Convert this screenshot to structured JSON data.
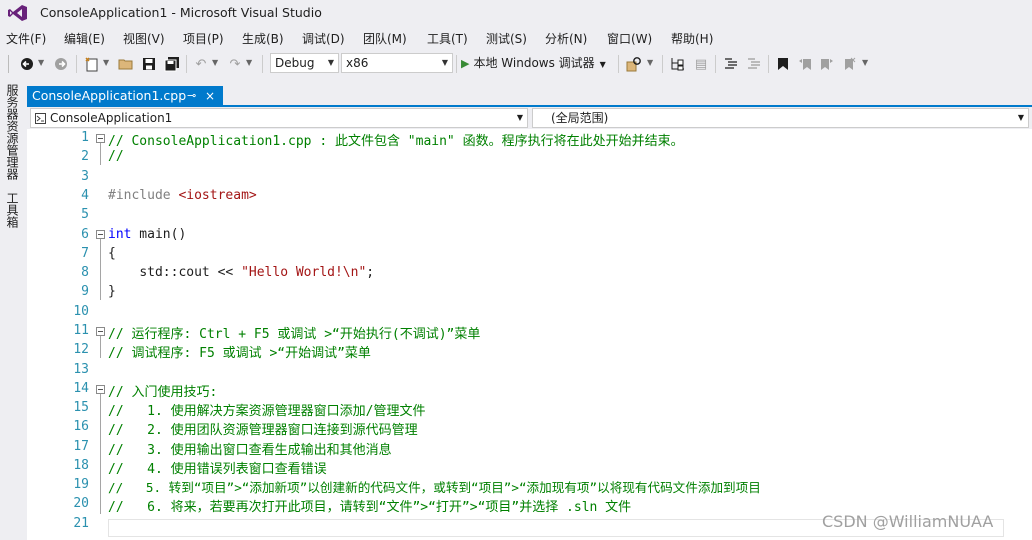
{
  "window": {
    "title": "ConsoleApplication1 - Microsoft Visual Studio"
  },
  "menu": [
    {
      "id": "file",
      "label": "文件(F)"
    },
    {
      "id": "edit",
      "label": "编辑(E)"
    },
    {
      "id": "view",
      "label": "视图(V)"
    },
    {
      "id": "project",
      "label": "项目(P)"
    },
    {
      "id": "build",
      "label": "生成(B)"
    },
    {
      "id": "debug",
      "label": "调试(D)"
    },
    {
      "id": "team",
      "label": "团队(M)"
    },
    {
      "id": "tools",
      "label": "工具(T)"
    },
    {
      "id": "test",
      "label": "测试(S)"
    },
    {
      "id": "analyze",
      "label": "分析(N)"
    },
    {
      "id": "window",
      "label": "窗口(W)"
    },
    {
      "id": "help",
      "label": "帮助(H)"
    }
  ],
  "toolbar": {
    "config": "Debug",
    "platform": "x86",
    "run_label": "本地 Windows 调试器"
  },
  "side_tabs": {
    "server_explorer": "服务器资源管理器",
    "toolbox": "工具箱"
  },
  "doc_tab": {
    "label": "ConsoleApplication1.cpp",
    "pin": "⊸",
    "close": "×"
  },
  "nav": {
    "project": "ConsoleApplication1",
    "scope": "(全局范围)"
  },
  "code_lines": [
    {
      "n": "1",
      "t": "// ConsoleApplication1.cpp : 此文件包含 \"main\" 函数。程序执行将在此处开始并结束。"
    },
    {
      "n": "2",
      "t": "//"
    },
    {
      "n": "3",
      "t": ""
    },
    {
      "n": "4",
      "t": "#include <iostream>"
    },
    {
      "n": "5",
      "t": ""
    },
    {
      "n": "6",
      "t": "int main()"
    },
    {
      "n": "7",
      "t": "{"
    },
    {
      "n": "8",
      "t": "    std::cout << \"Hello World!\\n\";"
    },
    {
      "n": "9",
      "t": "}"
    },
    {
      "n": "10",
      "t": ""
    },
    {
      "n": "11",
      "t": "// 运行程序: Ctrl + F5 或调试 >“开始执行(不调试)”菜单"
    },
    {
      "n": "12",
      "t": "// 调试程序: F5 或调试 >“开始调试”菜单"
    },
    {
      "n": "13",
      "t": ""
    },
    {
      "n": "14",
      "t": "// 入门使用技巧:"
    },
    {
      "n": "15",
      "t": "//   1. 使用解决方案资源管理器窗口添加/管理文件"
    },
    {
      "n": "16",
      "t": "//   2. 使用团队资源管理器窗口连接到源代码管理"
    },
    {
      "n": "17",
      "t": "//   3. 使用输出窗口查看生成输出和其他消息"
    },
    {
      "n": "18",
      "t": "//   4. 使用错误列表窗口查看错误"
    },
    {
      "n": "19",
      "t": "//   5. 转到“项目”>“添加新项”以创建新的代码文件，或转到“项目”>“添加现有项”以将现有代码文件添加到项目"
    },
    {
      "n": "20",
      "t": "//   6. 将来，若要再次打开此项目，请转到“文件”>“打开”>“项目”并选择 .sln 文件"
    },
    {
      "n": "21",
      "t": ""
    }
  ],
  "code_parts": {
    "include_kw": "#include",
    "include_file": "<iostream>",
    "int_kw": "int",
    "main_rest": " main()",
    "cout": "std::cout << ",
    "hello": "\"Hello World!\\n\"",
    "semi": ";"
  },
  "watermark": "CSDN @WilliamNUAA",
  "colors": {
    "accent": "#007acc",
    "comment": "#008000",
    "keyword": "#0000ff",
    "string": "#a31515",
    "line_number": "#2b91af",
    "preprocessor": "#808080"
  }
}
